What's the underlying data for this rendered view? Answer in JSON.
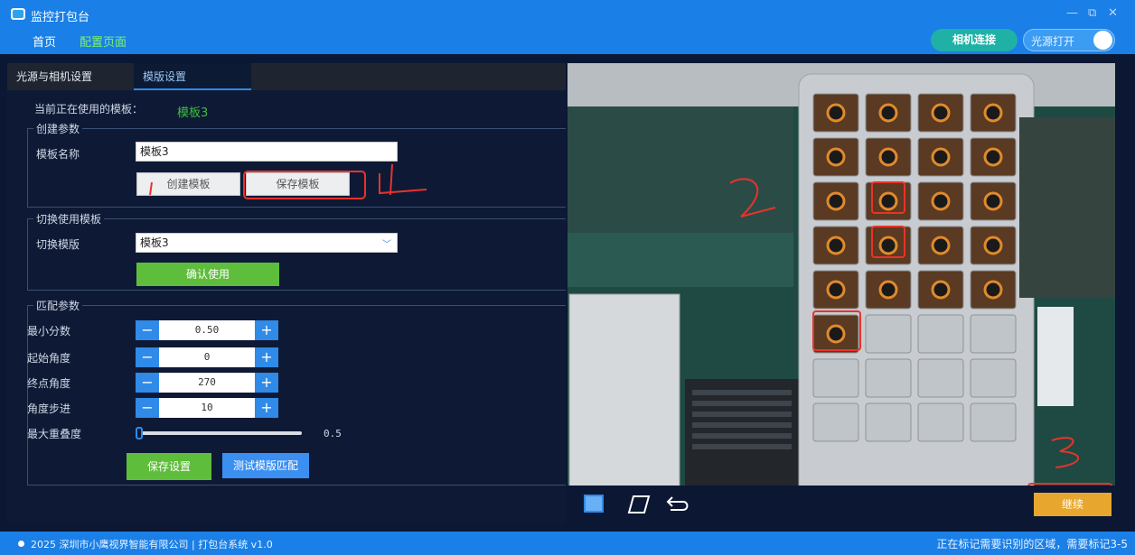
{
  "window": {
    "title": "监控打包台",
    "minimize": "—",
    "restore": "⧉",
    "close": "✕"
  },
  "nav": {
    "home": "首页",
    "config": "配置页面"
  },
  "header": {
    "camera_button": "相机连接",
    "light_toggle": "光源打开",
    "light_on": true
  },
  "tabs": [
    "光源与相机设置",
    "模版设置"
  ],
  "current": {
    "label": "当前正在使用的模板：",
    "value": "模板3"
  },
  "create": {
    "legend": "创建参数",
    "name_label": "模板名称",
    "name_value": "模板3",
    "create_button": "创建模板",
    "save_button": "保存模板"
  },
  "switch": {
    "legend": "切换使用模板",
    "label": "切换模版",
    "selected": "模板3",
    "confirm_button": "确认使用"
  },
  "match": {
    "legend": "匹配参数",
    "min_score_label": "最小分数",
    "min_score": "0.50",
    "start_angle_label": "起始角度",
    "start_angle": "0",
    "end_angle_label": "终点角度",
    "end_angle": "270",
    "angle_step_label": "角度步进",
    "angle_step": "10",
    "max_overlap_label": "最大重叠度",
    "max_overlap": "0.5",
    "max_overlap_level": 0.0,
    "save_button": "保存设置",
    "test_button": "测试模版匹配"
  },
  "annotations": {
    "one": "1",
    "two": "2",
    "three": "3",
    "four": "4"
  },
  "image_tools": {
    "continue_button": "继续"
  },
  "footer": {
    "copyright": "2025 深圳市小鹰视界智能有限公司 | 打包台系统 v1.0",
    "status": "正在标记需要识别的区域，需要标记3-5"
  },
  "colors": {
    "titlebar": "#1a7fe6",
    "accent_green": "#7ef26f",
    "annotation_red": "#e8332a",
    "continue": "#e7a72f"
  }
}
